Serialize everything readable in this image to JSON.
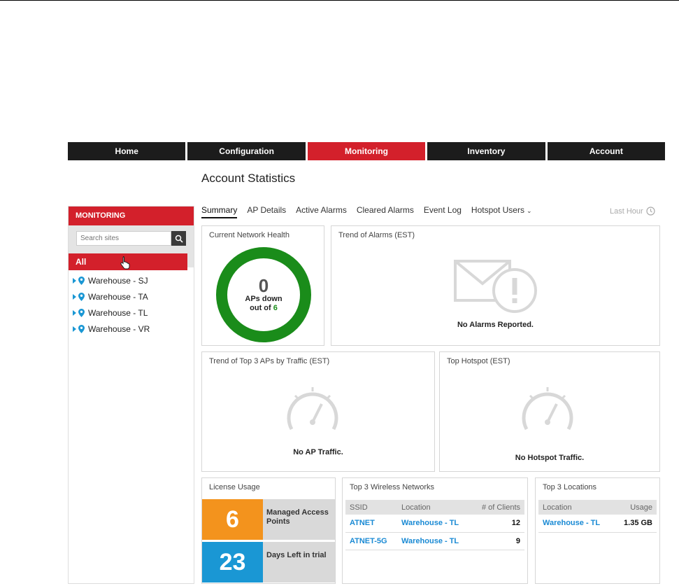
{
  "nav": {
    "tabs": [
      "Home",
      "Configuration",
      "Monitoring",
      "Inventory",
      "Account"
    ],
    "active_tab": "Monitoring"
  },
  "page_title": "Account Statistics",
  "sidebar": {
    "header": "MONITORING",
    "search_placeholder": "Search sites",
    "all_label": "All",
    "items": [
      "Warehouse - SJ",
      "Warehouse - TA",
      "Warehouse - TL",
      "Warehouse - VR"
    ]
  },
  "tabs": {
    "items": [
      "Summary",
      "AP Details",
      "Active Alarms",
      "Cleared Alarms",
      "Event Log",
      "Hotspot Users"
    ],
    "active": "Summary",
    "time_range": "Last Hour"
  },
  "health": {
    "title": "Current Network Health",
    "aps_down": "0",
    "label": "APs down",
    "out_of_prefix": "out of",
    "total": "6",
    "ring_color": "#1a8c1a"
  },
  "alarms": {
    "title": "Trend of Alarms (EST)",
    "empty": "No Alarms Reported."
  },
  "top_aps": {
    "title": "Trend of Top 3 APs by Traffic (EST)",
    "empty": "No AP Traffic."
  },
  "top_hotspot": {
    "title": "Top Hotspot (EST)",
    "empty": "No Hotspot Traffic."
  },
  "license": {
    "title": "License Usage",
    "managed_value": "6",
    "managed_label": "Managed Access Points",
    "days_value": "23",
    "days_label": "Days Left in trial",
    "managed_color": "#f3931d",
    "days_color": "#1a97d4"
  },
  "wireless": {
    "title": "Top 3 Wireless Networks",
    "headers": [
      "SSID",
      "Location",
      "# of Clients"
    ],
    "rows": [
      [
        "ATNET",
        "Warehouse - TL",
        "12"
      ],
      [
        "ATNET-5G",
        "Warehouse - TL",
        "9"
      ]
    ]
  },
  "locations": {
    "title": "Top 3 Locations",
    "headers": [
      "Location",
      "Usage"
    ],
    "rows": [
      [
        "Warehouse - TL",
        "1.35 GB"
      ]
    ]
  },
  "colors": {
    "brand_red": "#d3202b",
    "link_blue": "#1a8ad4"
  }
}
